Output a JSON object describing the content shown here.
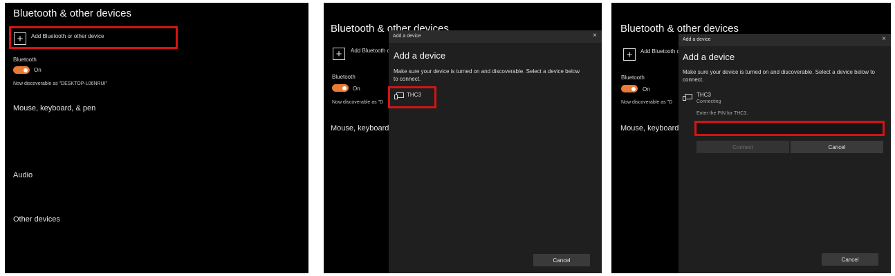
{
  "settings": {
    "title": "Bluetooth & other devices",
    "add_label": "Add Bluetooth or other device",
    "bluetooth_label": "Bluetooth",
    "toggle_state": "On",
    "discoverable_text": "Now discoverable as \"DESKTOP-L06NRUI\"",
    "discoverable_partial": "Now discoverable as \"D",
    "add_label_partial": "Add Bluetooth c",
    "mouse_section": "Mouse, keyboard, & pen",
    "mouse_section_partial": "Mouse, keyboard",
    "audio_section": "Audio",
    "other_section": "Other devices",
    "accent_color": "#e87b35"
  },
  "dialog": {
    "caption": "Add a device",
    "close_glyph": "×",
    "heading": "Add a device",
    "instructions": "Make sure your device is turned on and discoverable. Select a device below to connect.",
    "device_name": "THC3",
    "device_status": "Connecting",
    "pin_prompt": "Enter the PIN for THC3.",
    "pin_value": "",
    "connect_label": "Connect",
    "cancel_label": "Cancel"
  },
  "highlight_color": "#d41414"
}
